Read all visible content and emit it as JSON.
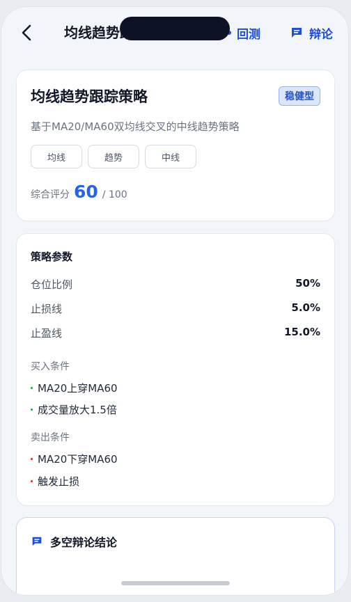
{
  "header": {
    "title": "均线趋势跟踪策略",
    "backtest_label": "回测",
    "debate_label": "辩论"
  },
  "strategy": {
    "name": "均线趋势跟踪策略",
    "risk_badge": "稳健型",
    "description": "基于MA20/MA60双均线交叉的中线趋势策略",
    "tags": [
      "均线",
      "趋势",
      "中线"
    ],
    "score_label": "综合评分",
    "score": "60",
    "score_max": "/ 100"
  },
  "params": {
    "title": "策略参数",
    "rows": [
      {
        "label": "仓位比例",
        "value": "50%"
      },
      {
        "label": "止损线",
        "value": "5.0%"
      },
      {
        "label": "止盈线",
        "value": "15.0%"
      }
    ],
    "buy_title": "买入条件",
    "buy_conditions": [
      "MA20上穿MA60",
      "成交量放大1.5倍"
    ],
    "sell_title": "卖出条件",
    "sell_conditions": [
      "MA20下穿MA60",
      "触发止损"
    ]
  },
  "conclusion": {
    "title": "多空辩论结论"
  },
  "icons": {
    "back": "chevron-left-icon",
    "debate": "chat-bubble-icon"
  },
  "colors": {
    "accent": "#1d4ed8",
    "score": "#2563eb",
    "badge_bg": "#dbe6fb",
    "buy_bullet": "#16a34a",
    "sell_bullet": "#dc2626"
  }
}
